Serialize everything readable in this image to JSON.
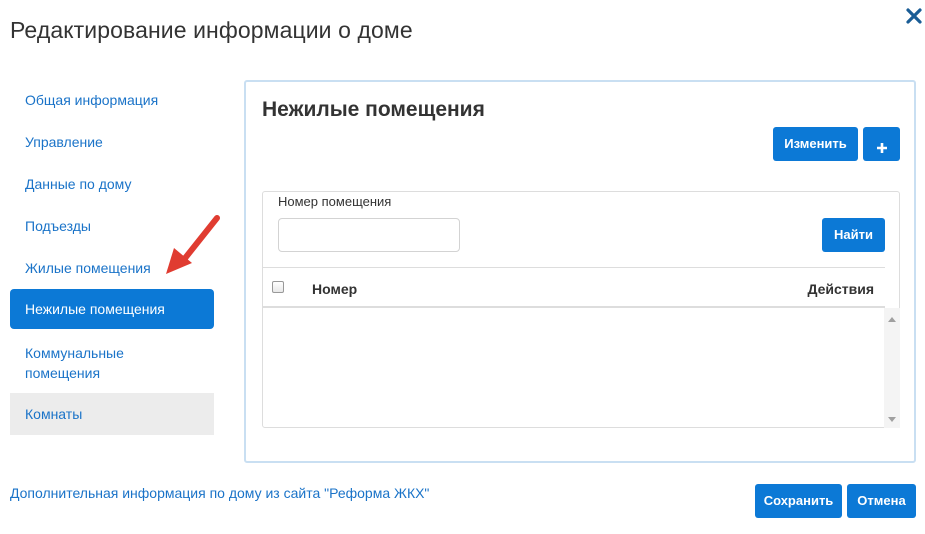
{
  "modal": {
    "title": "Редактирование информации о доме",
    "close_icon": "close-icon"
  },
  "sidebar": {
    "items": [
      {
        "label": "Общая информация"
      },
      {
        "label": "Управление"
      },
      {
        "label": "Данные по дому"
      },
      {
        "label": "Подъезды"
      },
      {
        "label": "Жилые помещения"
      },
      {
        "label": "Нежилые помещения"
      },
      {
        "label": "Коммунальные помещения"
      },
      {
        "label": "Комнаты"
      }
    ],
    "active_index": 5
  },
  "panel": {
    "title": "Нежилые помещения",
    "edit_label": "Изменить",
    "add_icon": "plus-icon",
    "search": {
      "label": "Номер помещения",
      "value": "",
      "find_label": "Найти"
    },
    "table": {
      "columns": [
        "Номер",
        "Действия"
      ],
      "rows": []
    }
  },
  "footer": {
    "link": "Дополнительная информация по дому из сайта \"Реформа ЖКХ\"",
    "save_label": "Сохранить",
    "cancel_label": "Отмена"
  },
  "colors": {
    "primary": "#0c79d6",
    "link": "#1a73c8",
    "annotation_arrow": "#e03c31"
  }
}
